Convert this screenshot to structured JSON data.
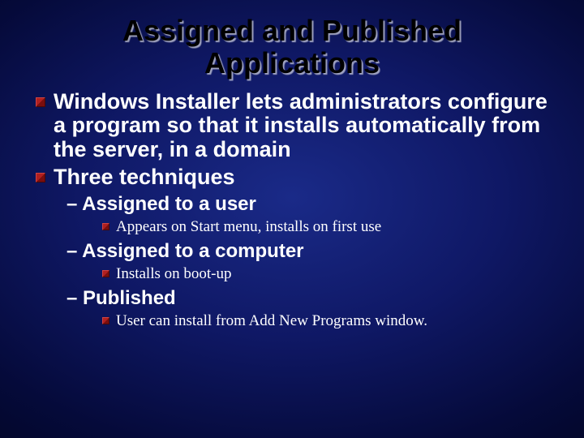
{
  "title_line1": "Assigned and Published",
  "title_line2": "Applications",
  "bullets": {
    "p1": "Windows Installer lets administrators configure a program so that it installs automatically from the server, in a domain",
    "p2": "Three techniques",
    "s1": "– Assigned to a user",
    "s1a": "Appears on Start menu, installs on first use",
    "s2": "– Assigned to a computer",
    "s2a": "Installs on boot-up",
    "s3": "– Published",
    "s3a": "User can install from Add New Programs window."
  }
}
